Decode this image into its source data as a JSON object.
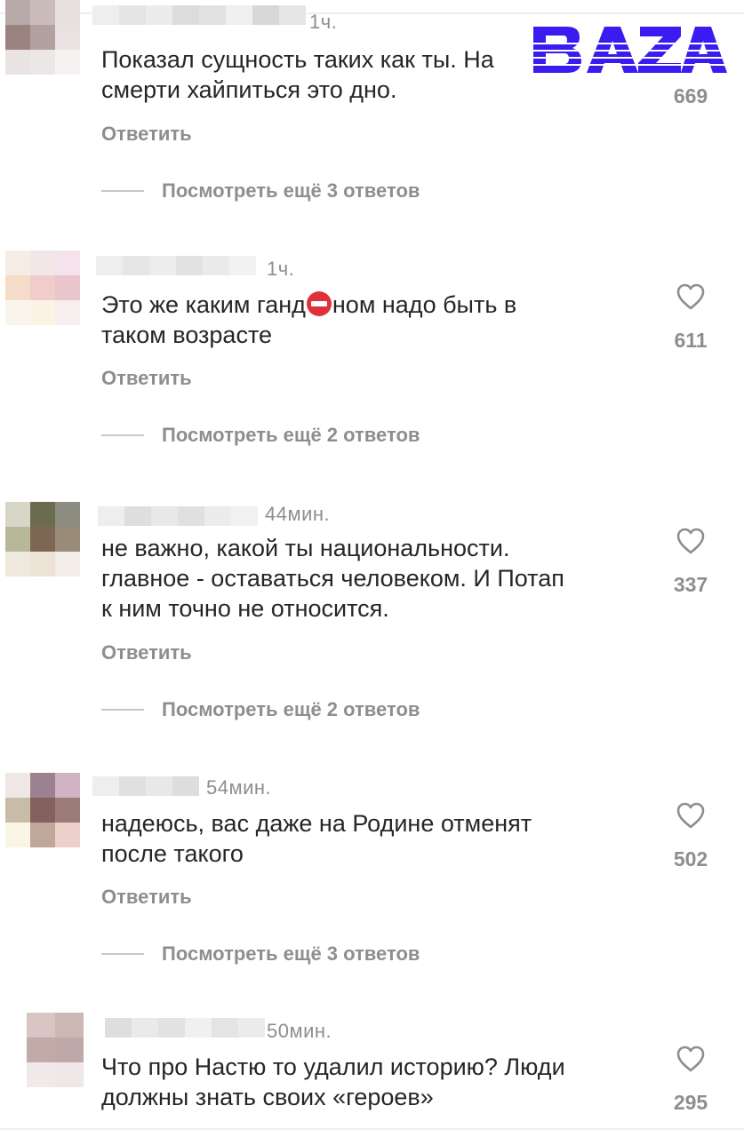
{
  "brand": {
    "logo_text": "BAZA",
    "logo_color": "#3a1cf0"
  },
  "colors": {
    "text": "#262626",
    "muted": "#8e8e8e",
    "separator": "#c7c7c7"
  },
  "comments": [
    {
      "time": "1ч.",
      "text_lines": [
        "Показал сущность таких как ты. На",
        "смерти хайпиться это дно."
      ],
      "likes": "669",
      "reply_label": "Ответить",
      "more_replies": "Посмотреть ещё 3 ответов",
      "avatar_colors": [
        "#b7aaa8",
        "#c9bcbb",
        "#e7dede",
        "#9a827f",
        "#b2a19f",
        "#eae2e2",
        "#e9e3e3",
        "#ece7e7",
        "#f6f2f2"
      ],
      "heart_icon": "heart-outline-icon"
    },
    {
      "time": "1ч.",
      "text_before_emoji": "Это же каким ганд",
      "emoji": "no-entry-emoji",
      "text_after_emoji": "ном надо быть в",
      "text_line2": "таком возрасте",
      "likes": "611",
      "reply_label": "Ответить",
      "more_replies": "Посмотреть ещё 2 ответов",
      "avatar_colors": [
        "#f6ece6",
        "#f3e6e6",
        "#f4e3ea",
        "#f5dcc9",
        "#f2cccc",
        "#e9c6cb",
        "#faf5ec",
        "#fbf3e4",
        "#f7efef"
      ],
      "heart_icon": "heart-outline-icon"
    },
    {
      "time": "44мин.",
      "text_lines": [
        "не важно, какой ты национальности.",
        "главное - оставаться человеком. И Потап",
        "к ним точно не относится."
      ],
      "likes": "337",
      "reply_label": "Ответить",
      "more_replies": "Посмотреть ещё 2 ответов",
      "avatar_colors": [
        "#d8d6c8",
        "#6b6b4f",
        "#8c8c80",
        "#b7b79a",
        "#7d6652",
        "#9a8a78",
        "#efe9dd",
        "#ece2d6",
        "#f2ede6"
      ],
      "heart_icon": "heart-outline-icon"
    },
    {
      "time": "54мин.",
      "text_lines": [
        "надеюсь, вас даже на Родине отменят",
        "после такого"
      ],
      "likes": "502",
      "reply_label": "Ответить",
      "more_replies": "Посмотреть ещё 3 ответов",
      "avatar_colors": [
        "#efe6e6",
        "#9c8291",
        "#cfb3c3",
        "#c8bba8",
        "#84605f",
        "#9c7c79",
        "#fbf5e6",
        "#bfa89a",
        "#ecd0c9"
      ],
      "heart_icon": "heart-outline-icon"
    },
    {
      "time": "50мин.",
      "text_lines": [
        "Что про Настю то удалил историю? Люди",
        "должны знать своих «героев»"
      ],
      "likes": "295",
      "reply_label": "",
      "more_replies": "",
      "avatar_colors": [
        "#d9c6c4",
        "#cdb8b6",
        "#f0e8e8",
        "#c2aaa9",
        "#bfa9a8",
        "#ede6e6",
        "#f0eaea",
        "#eee8e8",
        "#f6f2f2"
      ],
      "heart_icon": "heart-outline-icon"
    }
  ]
}
